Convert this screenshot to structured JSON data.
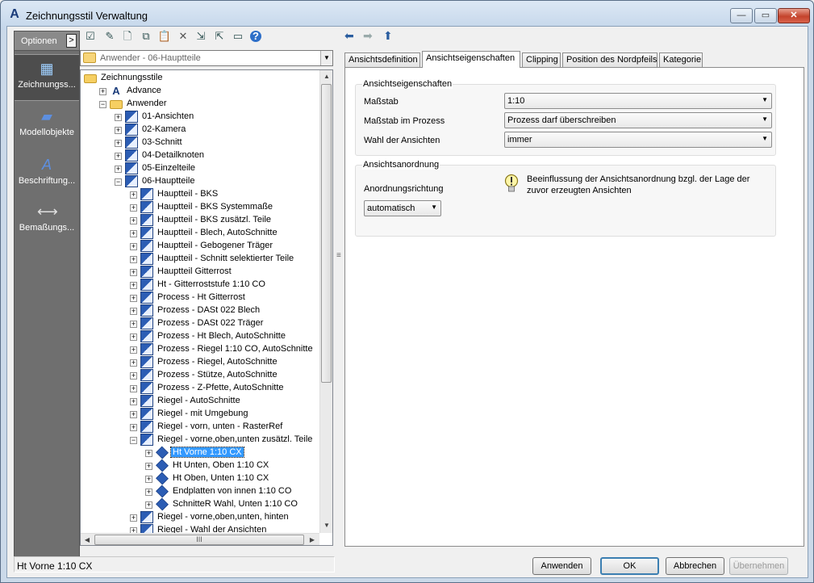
{
  "window": {
    "title": "Zeichnungsstil Verwaltung",
    "app_icon": "A",
    "min": "—",
    "max": "▭",
    "close": "✕"
  },
  "sidebar": {
    "options_label": "Optionen",
    "options_button": ">",
    "items": [
      {
        "label": "Zeichnungss...",
        "icon": "drawing-styles-icon",
        "glyph": "▦",
        "active": true
      },
      {
        "label": "Modellobjekte",
        "icon": "model-objects-icon",
        "glyph": "▰",
        "active": false
      },
      {
        "label": "Beschriftung...",
        "icon": "labeling-icon",
        "glyph": "A",
        "active": false
      },
      {
        "label": "Bemaßungs...",
        "icon": "dimension-icon",
        "glyph": "⟷",
        "active": false
      }
    ]
  },
  "toolbar": {
    "buttons": [
      {
        "name": "check-icon",
        "glyph": "☑"
      },
      {
        "name": "edit-icon",
        "glyph": "✎"
      },
      {
        "name": "new-icon",
        "glyph": "🗋"
      },
      {
        "name": "copy-icon",
        "glyph": "⧉"
      },
      {
        "name": "paste-icon",
        "glyph": "📋"
      },
      {
        "name": "delete-icon",
        "glyph": "✕"
      },
      {
        "name": "import-icon",
        "glyph": "⇲"
      },
      {
        "name": "export-icon",
        "glyph": "⇱"
      },
      {
        "name": "monitor-icon",
        "glyph": "▭"
      },
      {
        "name": "help-icon",
        "glyph": "?"
      }
    ],
    "nav": {
      "back": "⬅",
      "forward": "➡",
      "up": "⬆"
    }
  },
  "combo": {
    "value": "Anwender - 06-Hauptteile"
  },
  "tree": {
    "rows": [
      {
        "level": 0,
        "exp": "",
        "icon": "folder",
        "label": "Zeichnungsstile"
      },
      {
        "level": 1,
        "exp": "+",
        "icon": "a",
        "label": "Advance"
      },
      {
        "level": 1,
        "exp": "−",
        "icon": "folder",
        "label": "Anwender"
      },
      {
        "level": 2,
        "exp": "+",
        "icon": "style",
        "label": "01-Ansichten"
      },
      {
        "level": 2,
        "exp": "+",
        "icon": "style",
        "label": "02-Kamera"
      },
      {
        "level": 2,
        "exp": "+",
        "icon": "style",
        "label": "03-Schnitt"
      },
      {
        "level": 2,
        "exp": "+",
        "icon": "style",
        "label": "04-Detailknoten"
      },
      {
        "level": 2,
        "exp": "+",
        "icon": "style",
        "label": "05-Einzelteile"
      },
      {
        "level": 2,
        "exp": "−",
        "icon": "style",
        "label": "06-Hauptteile"
      },
      {
        "level": 3,
        "exp": "+",
        "icon": "style",
        "label": "Hauptteil - BKS"
      },
      {
        "level": 3,
        "exp": "+",
        "icon": "style",
        "label": "Hauptteil - BKS Systemmaße"
      },
      {
        "level": 3,
        "exp": "+",
        "icon": "style",
        "label": "Hauptteil - BKS zusätzl. Teile"
      },
      {
        "level": 3,
        "exp": "+",
        "icon": "style",
        "label": "Hauptteil - Blech, AutoSchnitte"
      },
      {
        "level": 3,
        "exp": "+",
        "icon": "style",
        "label": "Hauptteil - Gebogener Träger"
      },
      {
        "level": 3,
        "exp": "+",
        "icon": "style",
        "label": "Hauptteil - Schnitt selektierter Teile"
      },
      {
        "level": 3,
        "exp": "+",
        "icon": "style",
        "label": "Hauptteil Gitterrost"
      },
      {
        "level": 3,
        "exp": "+",
        "icon": "style",
        "label": "Ht - Gitterroststufe 1:10 CO"
      },
      {
        "level": 3,
        "exp": "+",
        "icon": "style",
        "label": "Process - Ht Gitterrost"
      },
      {
        "level": 3,
        "exp": "+",
        "icon": "style",
        "label": "Prozess - DASt 022 Blech"
      },
      {
        "level": 3,
        "exp": "+",
        "icon": "style",
        "label": "Prozess - DASt 022 Träger"
      },
      {
        "level": 3,
        "exp": "+",
        "icon": "style",
        "label": "Prozess - Ht Blech, AutoSchnitte"
      },
      {
        "level": 3,
        "exp": "+",
        "icon": "style",
        "label": "Prozess - Riegel 1:10 CO, AutoSchnitte"
      },
      {
        "level": 3,
        "exp": "+",
        "icon": "style",
        "label": "Prozess - Riegel, AutoSchnitte"
      },
      {
        "level": 3,
        "exp": "+",
        "icon": "style",
        "label": "Prozess - Stütze, AutoSchnitte"
      },
      {
        "level": 3,
        "exp": "+",
        "icon": "style",
        "label": "Prozess - Z-Pfette, AutoSchnitte"
      },
      {
        "level": 3,
        "exp": "+",
        "icon": "style",
        "label": "Riegel - AutoSchnitte"
      },
      {
        "level": 3,
        "exp": "+",
        "icon": "style",
        "label": "Riegel - mit Umgebung"
      },
      {
        "level": 3,
        "exp": "+",
        "icon": "style",
        "label": "Riegel - vorn, unten - RasterRef"
      },
      {
        "level": 3,
        "exp": "−",
        "icon": "style",
        "label": "Riegel - vorne,oben,unten zusätzl. Teile"
      },
      {
        "level": 4,
        "exp": "+",
        "icon": "view",
        "label": "Ht Vorne 1:10 CX",
        "selected": true
      },
      {
        "level": 4,
        "exp": "+",
        "icon": "view",
        "label": "Ht Unten, Oben 1:10 CX"
      },
      {
        "level": 4,
        "exp": "+",
        "icon": "view",
        "label": "Ht Oben, Unten 1:10 CX"
      },
      {
        "level": 4,
        "exp": "+",
        "icon": "view",
        "label": "Endplatten von innen 1:10 CO"
      },
      {
        "level": 4,
        "exp": "+",
        "icon": "view",
        "label": "SchnitteR Wahl, Unten 1:10 CO"
      },
      {
        "level": 3,
        "exp": "+",
        "icon": "style",
        "label": "Riegel - vorne,oben,unten, hinten"
      },
      {
        "level": 3,
        "exp": "+",
        "icon": "style",
        "label": "Riegel - Wahl der Ansichten"
      }
    ],
    "scroll": {
      "up": "▲",
      "down": "▼",
      "left": "◀",
      "right": "▶",
      "grip": "III",
      "split_grip": "≡"
    }
  },
  "tabs": [
    {
      "label": "Ansichtsdefinition",
      "active": false
    },
    {
      "label": "Ansichtseigenschaften",
      "active": true
    },
    {
      "label": "Clipping",
      "active": false
    },
    {
      "label": "Position des Nordpfeils",
      "active": false
    },
    {
      "label": "Kategorie",
      "active": false
    }
  ],
  "properties": {
    "group1": {
      "title": "Ansichtseigenschaften",
      "rows": [
        {
          "label": "Maßstab",
          "value": "1:10"
        },
        {
          "label": "Maßstab im Prozess",
          "value": "Prozess darf überschreiben"
        },
        {
          "label": "Wahl der Ansichten",
          "value": "immer"
        }
      ]
    },
    "group2": {
      "title": "Ansichtsanordnung",
      "label": "Anordnungsrichtung",
      "value": "automatisch",
      "hint": "Beeinflussung der Ansichtsanordnung bzgl. der Lage der zuvor erzeugten Ansichten"
    },
    "arrow": "▼"
  },
  "status": {
    "text": "Ht Vorne 1:10 CX"
  },
  "buttons": {
    "apply": "Anwenden",
    "ok": "OK",
    "cancel": "Abbrechen",
    "take": "Übernehmen"
  }
}
